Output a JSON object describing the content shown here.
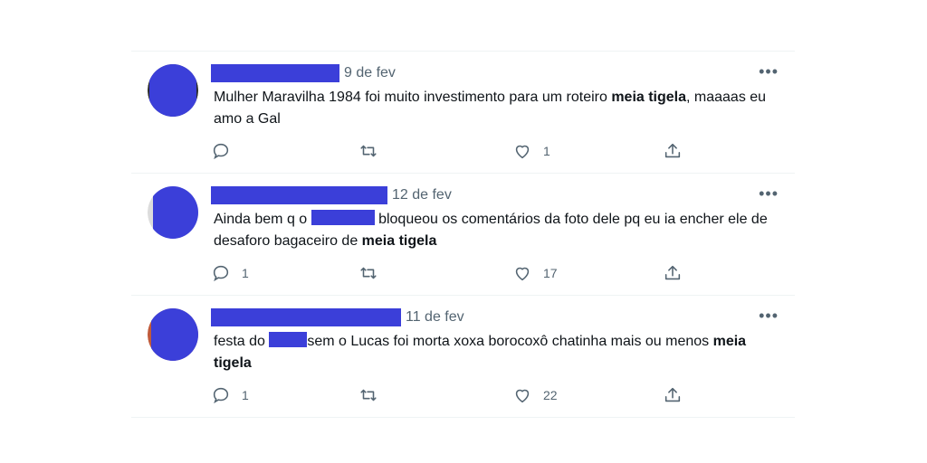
{
  "tweets": [
    {
      "date": "9 de fev",
      "text_before": "Mulher Maravilha 1984 foi muito investimento para um roteiro ",
      "bold": "meia tigela",
      "text_after": ", maaaas eu amo a Gal",
      "reply_count": "",
      "like_count": "1",
      "more_label": "•••"
    },
    {
      "date": "12 de fev",
      "text_before": "Ainda bem q o ",
      "text_mid": " bloqueou os comentários da foto dele pq eu ia encher ele de desaforo bagaceiro de ",
      "bold": "meia tigela",
      "reply_count": "1",
      "like_count": "17",
      "more_label": "•••"
    },
    {
      "date": "11 de fev",
      "text_before": "festa do ",
      "text_mid": "sem o Lucas foi morta xoxa borocoxô chatinha mais ou menos ",
      "bold": "meia tigela",
      "reply_count": "1",
      "like_count": "22",
      "more_label": "•••"
    }
  ],
  "icons": [
    "reply-icon",
    "retweet-icon",
    "like-icon",
    "share-icon"
  ],
  "colors": {
    "redaction": "#3b3fd9",
    "muted": "#536471",
    "divider": "#eff3f4"
  }
}
